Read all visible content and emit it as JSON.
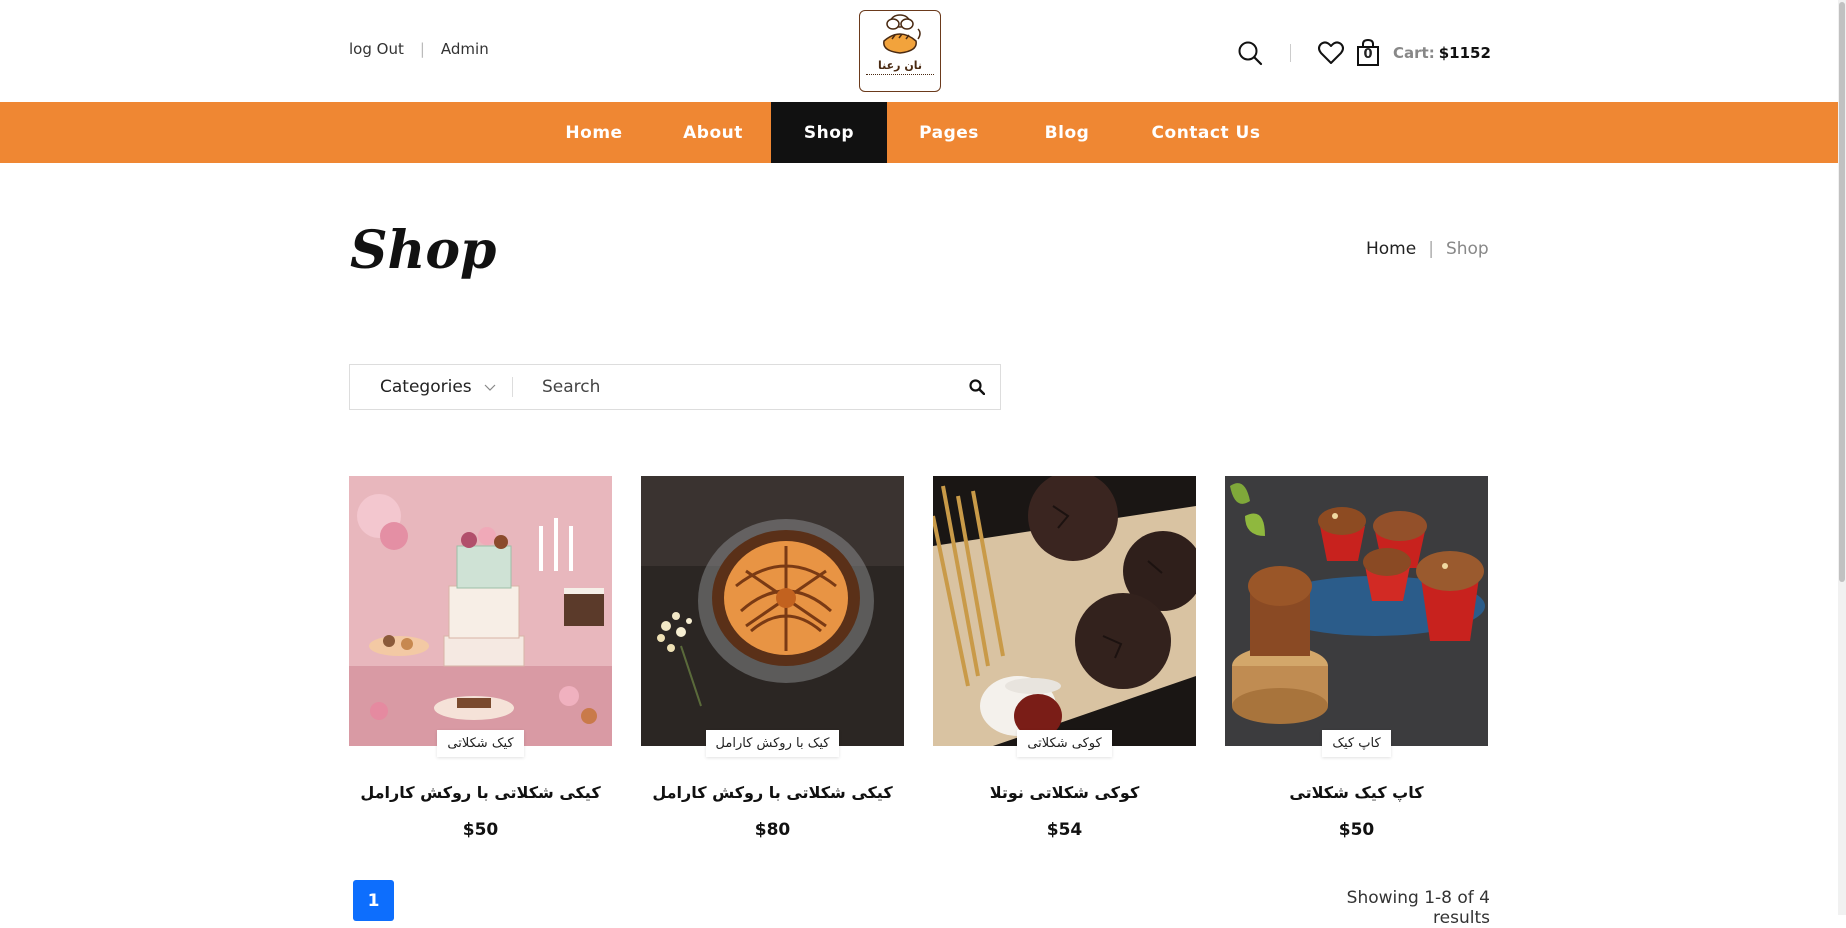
{
  "header": {
    "logout_label": "log Out",
    "admin_label": "Admin",
    "logo_text": "نان رعنا",
    "cart_count": "0",
    "cart_label": "Cart:",
    "cart_total": "$1152"
  },
  "nav": {
    "items": [
      {
        "label": "Home"
      },
      {
        "label": "About"
      },
      {
        "label": "Shop"
      },
      {
        "label": "Pages"
      },
      {
        "label": "Blog"
      },
      {
        "label": "Contact Us"
      }
    ],
    "active": "Shop"
  },
  "page": {
    "title": "Shop",
    "breadcrumb": {
      "home": "Home",
      "current": "Shop"
    }
  },
  "search": {
    "categories_label": "Categories",
    "placeholder": "Search"
  },
  "products": [
    {
      "tag": "کیک شکلاتی",
      "name": "کیکی شکلاتی با روکش کارامل",
      "price": "$50",
      "image": "decorated-cake-table-photo"
    },
    {
      "tag": "کیک با روکش کارامل",
      "name": "کیکی شکلاتی با روکش کارامل",
      "price": "$80",
      "image": "caramel-cake-photo"
    },
    {
      "tag": "کوکی شکلاتی",
      "name": "کوکی شکلاتی نوتلا",
      "price": "$54",
      "image": "chocolate-cookies-photo"
    },
    {
      "tag": "کاپ کیک",
      "name": "کاپ کیک شکلاتی",
      "price": "$50",
      "image": "chocolate-cupcakes-photo"
    }
  ],
  "pagination": {
    "current": "1"
  },
  "results_text": "Showing 1-8 of 4 results",
  "colors": {
    "nav_bg": "#ef8733",
    "nav_active_bg": "#111111",
    "page_button": "#0d6efd"
  }
}
